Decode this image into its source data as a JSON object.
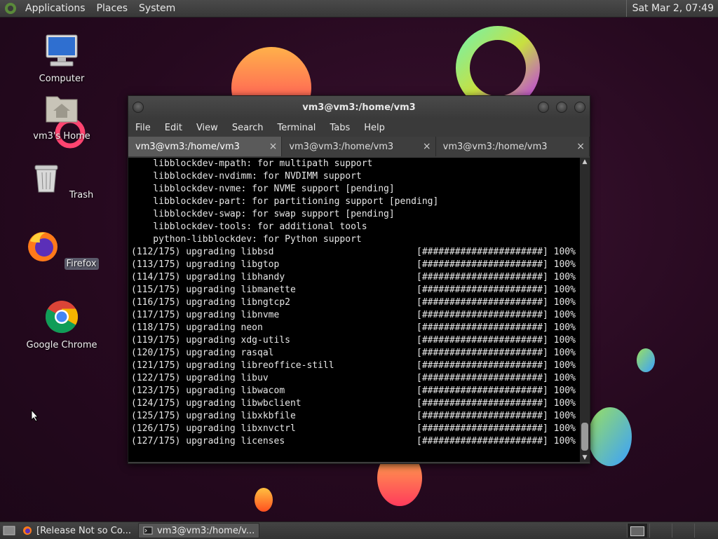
{
  "top_panel": {
    "menus": [
      "Applications",
      "Places",
      "System"
    ],
    "clock": "Sat Mar 2, 07:49"
  },
  "desktop": {
    "icons": [
      {
        "label": "Computer",
        "icon": "computer-icon"
      },
      {
        "label": "vm3's Home",
        "icon": "home-folder-icon"
      },
      {
        "label": "Trash",
        "icon": "trash-icon"
      },
      {
        "label": "Firefox",
        "icon": "firefox-icon"
      },
      {
        "label": "Google Chrome",
        "icon": "chrome-icon"
      }
    ]
  },
  "terminal": {
    "title": "vm3@vm3:/home/vm3",
    "menu": [
      "File",
      "Edit",
      "View",
      "Search",
      "Terminal",
      "Tabs",
      "Help"
    ],
    "tabs": [
      {
        "label": "vm3@vm3:/home/vm3",
        "close": "×"
      },
      {
        "label": "vm3@vm3:/home/vm3",
        "close": "×"
      },
      {
        "label": "vm3@vm3:/home/vm3",
        "close": "×"
      }
    ],
    "lines": [
      "    libblockdev-mpath: for multipath support",
      "    libblockdev-nvdimm: for NVDIMM support",
      "    libblockdev-nvme: for NVME support [pending]",
      "    libblockdev-part: for partitioning support [pending]",
      "    libblockdev-swap: for swap support [pending]",
      "    libblockdev-tools: for additional tools",
      "    python-libblockdev: for Python support",
      "(112/175) upgrading libbsd                          [######################] 100%",
      "(113/175) upgrading libgtop                         [######################] 100%",
      "(114/175) upgrading libhandy                        [######################] 100%",
      "(115/175) upgrading libmanette                      [######################] 100%",
      "(116/175) upgrading libngtcp2                       [######################] 100%",
      "(117/175) upgrading libnvme                         [######################] 100%",
      "(118/175) upgrading neon                            [######################] 100%",
      "(119/175) upgrading xdg-utils                       [######################] 100%",
      "(120/175) upgrading rasqal                          [######################] 100%",
      "(121/175) upgrading libreoffice-still               [######################] 100%",
      "(122/175) upgrading libuv                           [######################] 100%",
      "(123/175) upgrading libwacom                        [######################] 100%",
      "(124/175) upgrading libwbclient                     [######################] 100%",
      "(125/175) upgrading libxkbfile                      [######################] 100%",
      "(126/175) upgrading libxnvctrl                      [######################] 100%",
      "(127/175) upgrading licenses                        [######################] 100%"
    ]
  },
  "taskbar": {
    "tasks": [
      {
        "label": "[Release Not so Co...",
        "icon": "firefox-icon"
      },
      {
        "label": "vm3@vm3:/home/v...",
        "icon": "terminal-icon"
      }
    ]
  }
}
